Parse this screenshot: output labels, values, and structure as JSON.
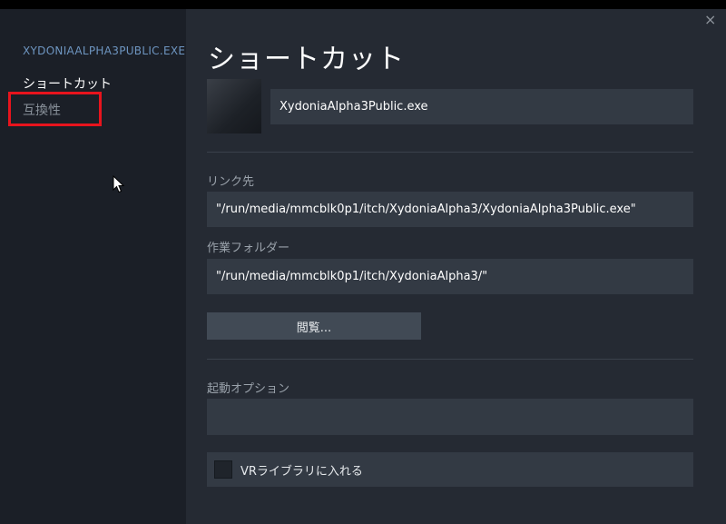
{
  "sidebar": {
    "title": "XYDONIAALPHA3PUBLIC.EXE",
    "items": [
      {
        "label": "ショートカット"
      },
      {
        "label": "互換性"
      }
    ]
  },
  "main": {
    "title": "ショートカット",
    "name_value": "XydoniaAlpha3Public.exe",
    "target_label": "リンク先",
    "target_value": "\"/run/media/mmcblk0p1/itch/XydoniaAlpha3/XydoniaAlpha3Public.exe\"",
    "start_in_label": "作業フォルダー",
    "start_in_value": "\"/run/media/mmcblk0p1/itch/XydoniaAlpha3/\"",
    "browse_label": "閲覧...",
    "launch_options_label": "起動オプション",
    "launch_options_value": "",
    "vr_label": "VRライブラリに入れる"
  },
  "icons": {
    "close": "×"
  },
  "colors": {
    "highlight": "#e8141d",
    "sidebar_title": "#6e95c0"
  }
}
